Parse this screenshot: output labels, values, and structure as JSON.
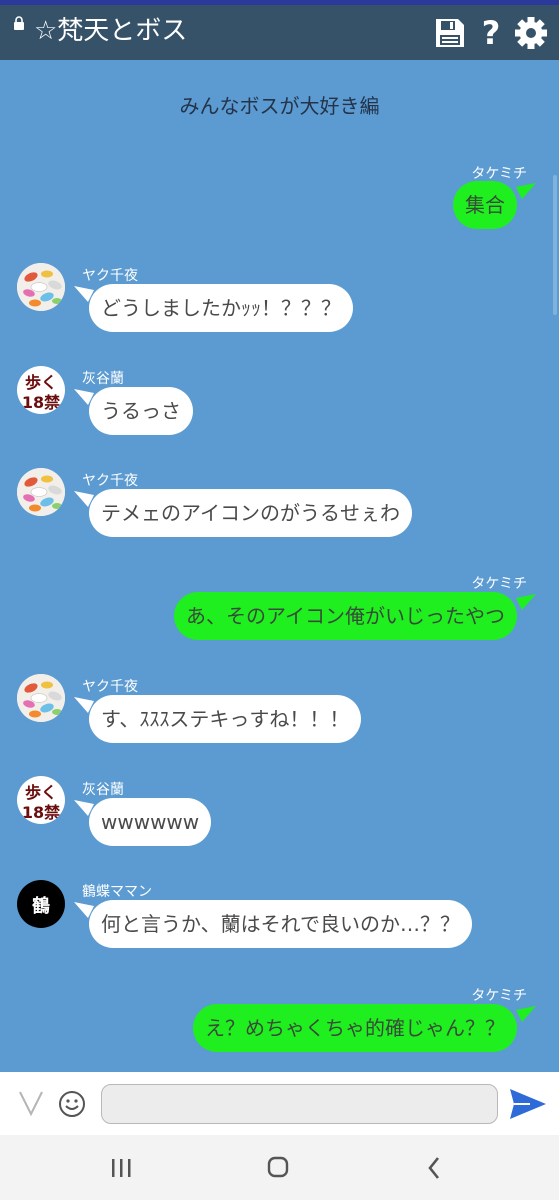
{
  "header": {
    "title": "☆梵天とボス",
    "icons": [
      "lock-icon",
      "save-icon",
      "help-icon",
      "gear-icon"
    ],
    "help_glyph": "?"
  },
  "chat": {
    "title": "みんなボスが大好き編",
    "messages": [
      {
        "side": "right",
        "sender": "タケミチ",
        "text": "集合"
      },
      {
        "side": "left",
        "sender": "ヤク千夜",
        "avatar": "pills",
        "text": "どうしましたかｯｯ！？？？"
      },
      {
        "side": "left",
        "sender": "灰谷蘭",
        "avatar": "aruku",
        "text": "うるっさ"
      },
      {
        "side": "left",
        "sender": "ヤク千夜",
        "avatar": "pills",
        "text": "テメェのアイコンのがうるせぇわ"
      },
      {
        "side": "right",
        "sender": "タケミチ",
        "text": "あ、そのアイコン俺がいじったやつ"
      },
      {
        "side": "left",
        "sender": "ヤク千夜",
        "avatar": "pills",
        "text": "す、ｽｽｽステキっすね！！！"
      },
      {
        "side": "left",
        "sender": "灰谷蘭",
        "avatar": "aruku",
        "text": "wwwwww"
      },
      {
        "side": "left",
        "sender": "鶴蝶ママン",
        "avatar": "crane",
        "text": "何と言うか、蘭はそれで良いのか…？？"
      },
      {
        "side": "right",
        "sender": "タケミチ",
        "text": "え？めちゃくちゃ的確じゃん？？"
      }
    ],
    "avatars": {
      "aruku_line1": "歩く",
      "aruku_line2": "18禁",
      "crane": "鶴"
    }
  },
  "input": {
    "value": "",
    "placeholder": ""
  },
  "colors": {
    "header_bg": "#355269",
    "chat_bg": "#5b9bd1",
    "right_bubble": "#1fef1f",
    "left_bubble": "#ffffff",
    "send_icon": "#2f6bd8"
  }
}
